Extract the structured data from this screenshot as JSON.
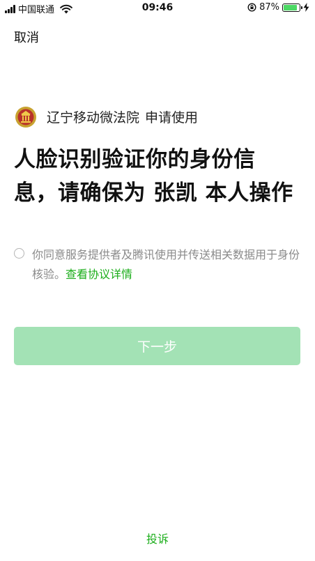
{
  "status_bar": {
    "carrier": "中国联通",
    "time": "09:46",
    "battery_percent": "87%",
    "battery_level": 0.87
  },
  "nav": {
    "cancel_label": "取消"
  },
  "app": {
    "name": "辽宁移动微法院",
    "action": "申请使用"
  },
  "headline": {
    "line1": "人脸识别验证你的身份信",
    "line2": "息，请确保为 张凯 本人操作"
  },
  "agreement": {
    "text": "你同意服务提供者及腾讯使用并传送相关数据用于身份核验。",
    "link": "查看协议详情",
    "checked": false
  },
  "next_button": {
    "label": "下一步"
  },
  "footer": {
    "complain_label": "投诉"
  },
  "colors": {
    "accent": "#1aad19",
    "button_disabled": "#a3e2b5",
    "muted_text": "#8a8a8a",
    "battery": "#4cd964"
  }
}
